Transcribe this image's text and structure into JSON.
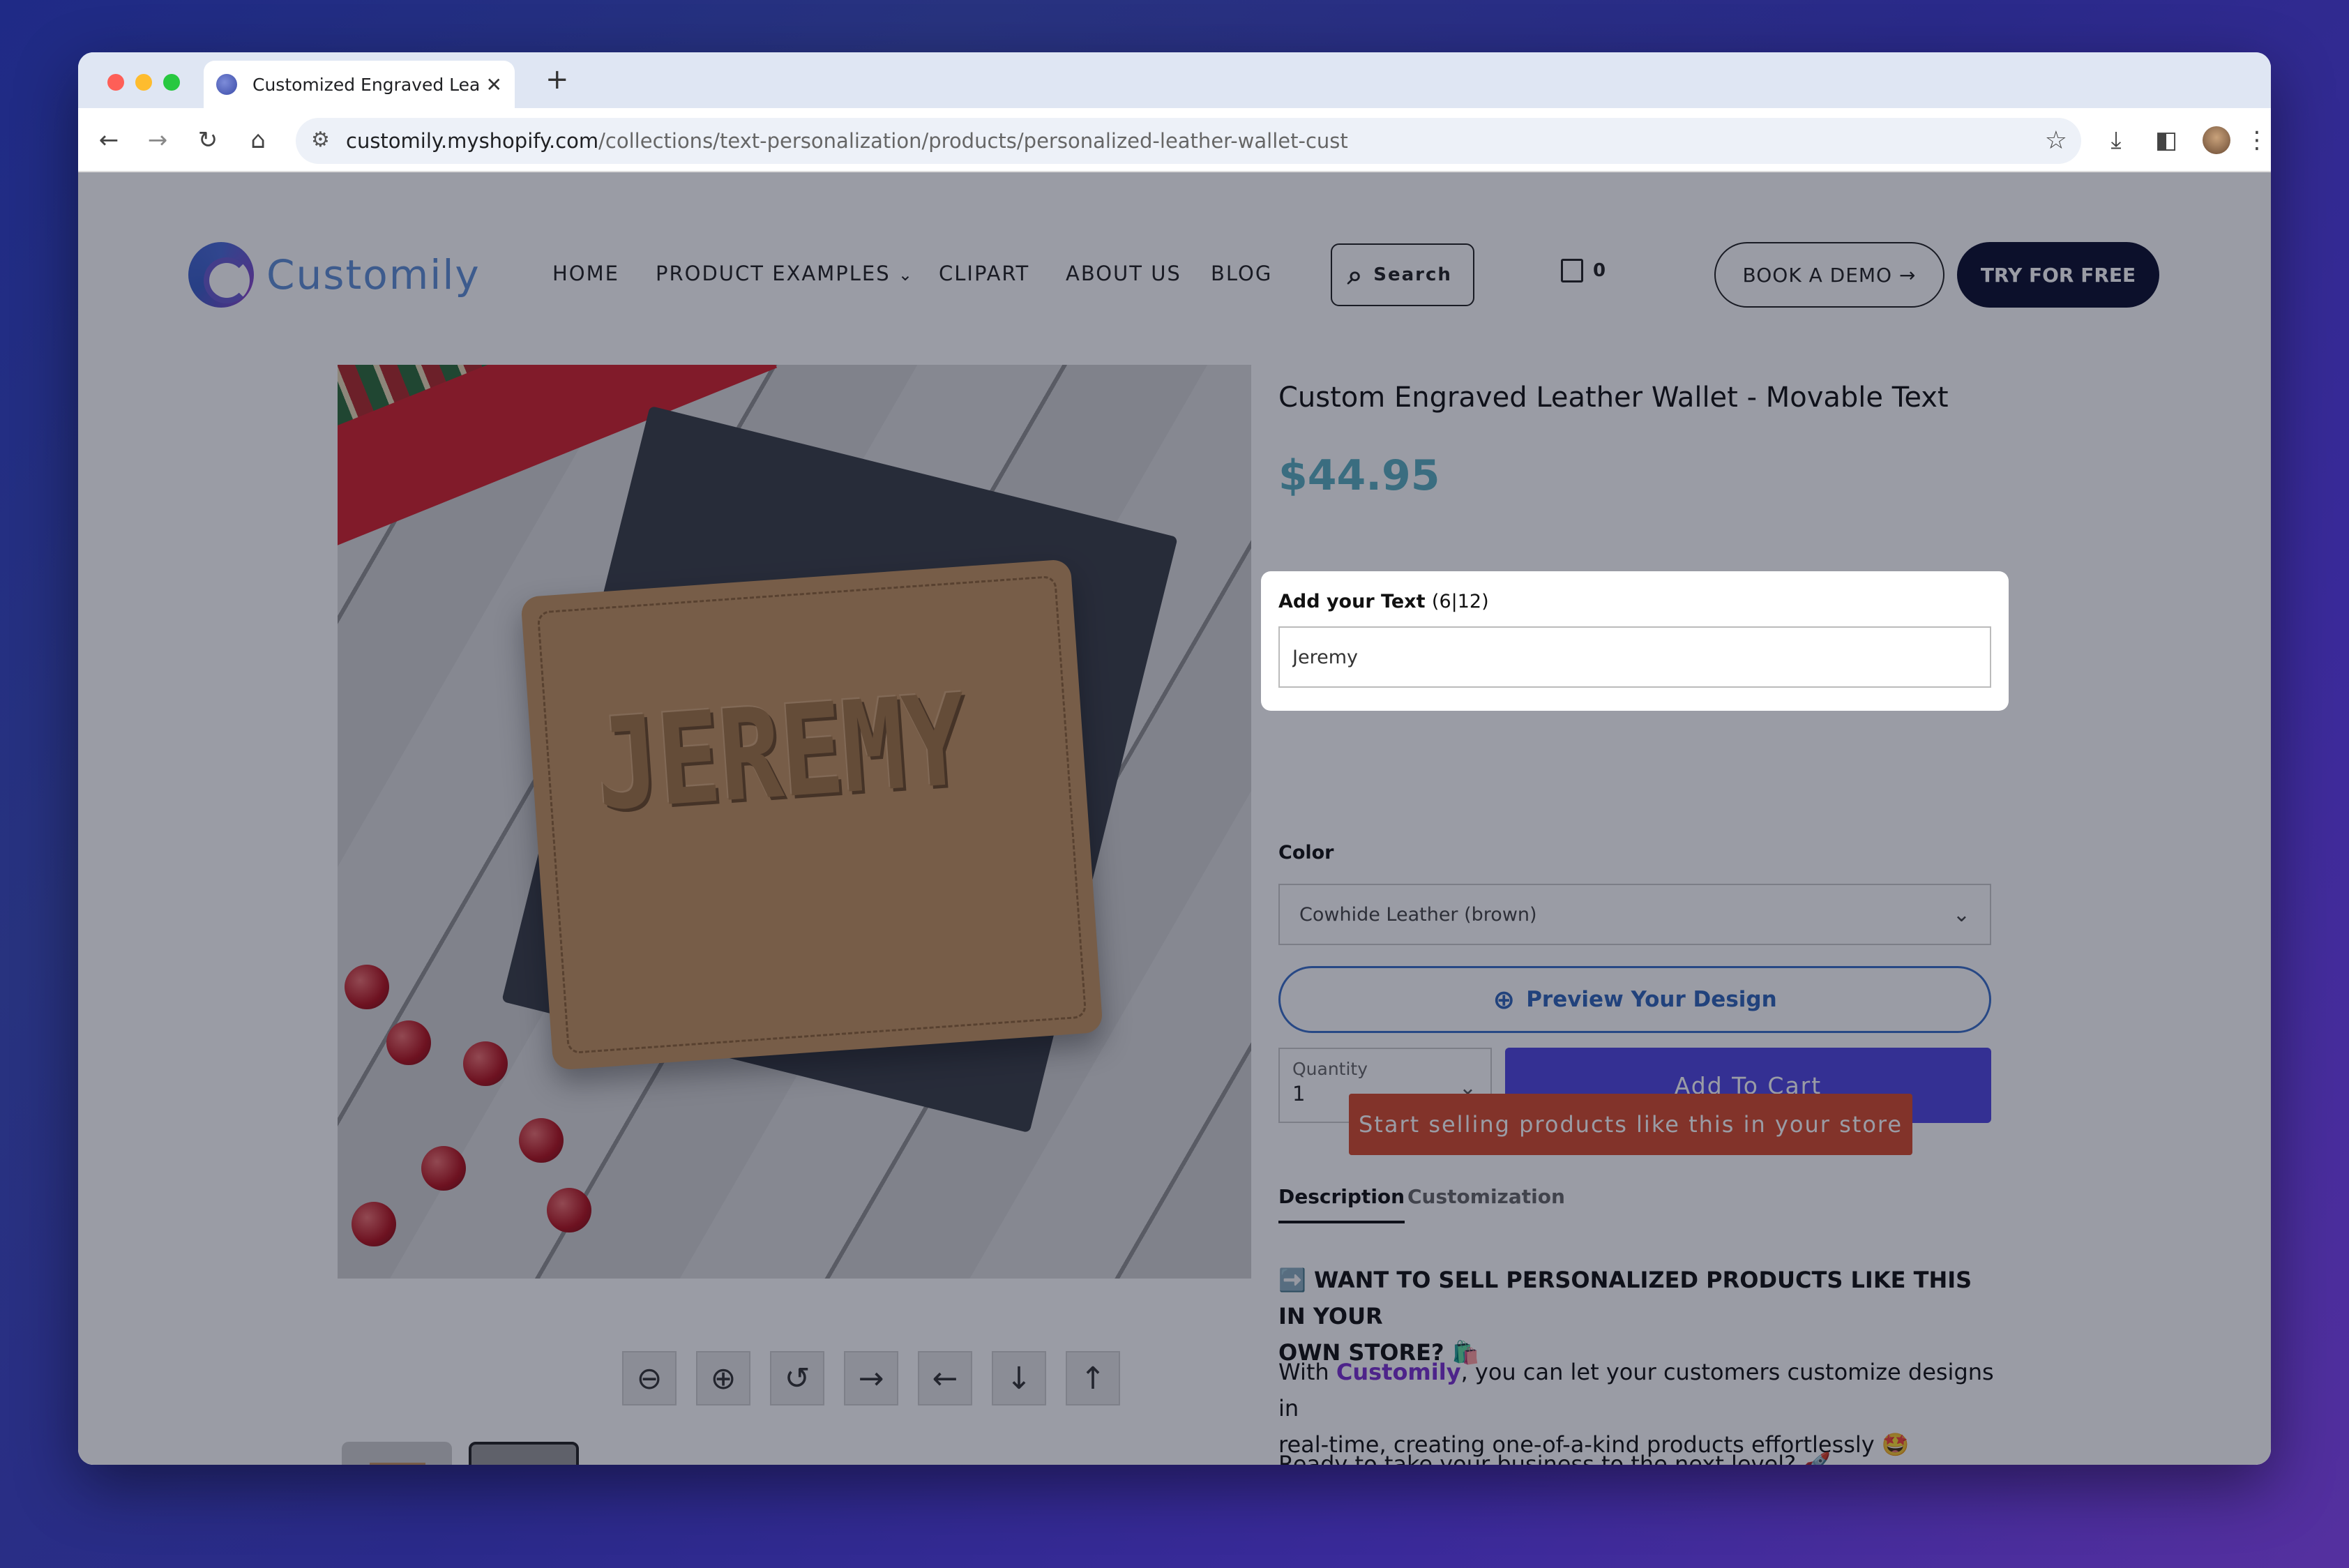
{
  "browser": {
    "tab_title": "Customized Engraved Leathe",
    "url_host": "customily.myshopify.com",
    "url_path": "/collections/text-personalization/products/personalized-leather-wallet-cust"
  },
  "header": {
    "logo_text": "Customily",
    "nav": [
      "HOME",
      "PRODUCT EXAMPLES",
      "CLIPART",
      "ABOUT US",
      "BLOG"
    ],
    "search_label": "Search",
    "cart_count": "0",
    "demo_label": "BOOK A DEMO →",
    "try_label": "TRY FOR FREE"
  },
  "product": {
    "engraving": "JEREMY",
    "title": "Custom Engraved Leather Wallet - Movable Text",
    "price": "$44.95",
    "text_label": "Add your Text",
    "text_count": "(6|12)",
    "text_value": "Jeremy",
    "color_label": "Color",
    "color_value": "Cowhide Leather (brown)",
    "preview_label": "Preview Your Design",
    "qty_label": "Quantity",
    "qty_value": "1",
    "addcart_label": "Add To Cart",
    "sell_label": "Start selling products like this in your store"
  },
  "tabs": {
    "description": "Description",
    "customization": "Customization"
  },
  "description": {
    "heading_1": "➡️ WANT TO SELL PERSONALIZED PRODUCTS LIKE THIS IN YOUR",
    "heading_2": "OWN STORE? 🛍️",
    "p1_pre": "With ",
    "p1_brand": "Customily",
    "p1_post": ", you can let your customers customize designs in",
    "p1_line2": "real-time, creating one-of-a-kind products effortlessly 🤩",
    "p2": "Ready to take your business to the next level? 🚀"
  }
}
